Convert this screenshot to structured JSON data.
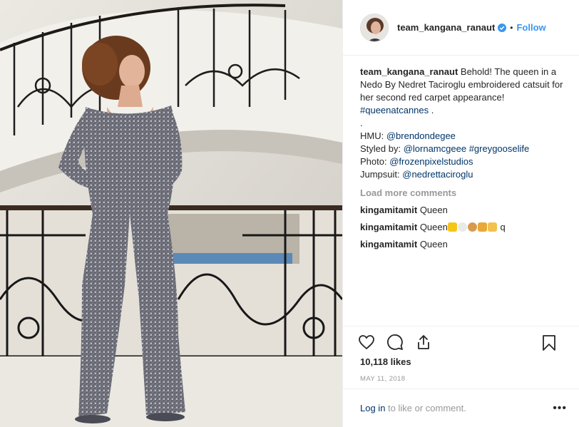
{
  "post": {
    "username": "team_kangana_ranaut",
    "follow_label": "Follow",
    "separator": "•",
    "caption": {
      "username": "team_kangana_ranaut",
      "text": "Behold! The queen in a Nedo By Nedret Taciroglu embroidered catsuit for her second red carpet appearance!",
      "hashtag": "#queenatcannes",
      "hashtag_suffix": " .",
      "dot_line": ".",
      "credits": [
        {
          "label": "HMU: ",
          "value": "@brendondegee",
          "extra": ""
        },
        {
          "label": "Styled by: ",
          "value": "@lornamcgeee",
          "extra": "#greygooselife"
        },
        {
          "label": "Photo: ",
          "value": "@frozenpixelstudios",
          "extra": ""
        },
        {
          "label": "Jumpsuit: ",
          "value": "@nedrettaciroglu",
          "extra": ""
        }
      ]
    },
    "load_more_label": "Load more comments",
    "comments": [
      {
        "user": "kingamitamit",
        "text": "Queen",
        "suffix": ""
      },
      {
        "user": "kingamitamit",
        "text": "Queen",
        "suffix": " q"
      },
      {
        "user": "kingamitamit",
        "text": "Queen",
        "suffix": ""
      }
    ],
    "likes": "10,118 likes",
    "date": "MAY 11, 2018",
    "footer": {
      "login_label": "Log in",
      "rest": " to like or comment.",
      "more": "•••"
    },
    "icons": {
      "like": "heart-icon",
      "comment": "comment-bubble-icon",
      "share": "share-icon",
      "save": "bookmark-icon",
      "verified": "verified-badge-icon"
    },
    "colors": {
      "link": "#003569",
      "accent": "#3897f0",
      "muted": "#999999"
    }
  }
}
